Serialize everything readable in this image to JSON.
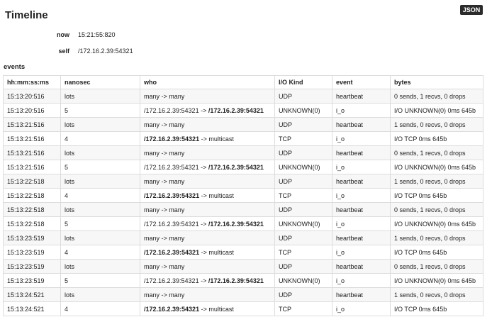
{
  "header": {
    "title": "Timeline",
    "json_button": "JSON"
  },
  "info": {
    "now_label": "now",
    "now_value": "15:21:55:820",
    "self_label": "self",
    "self_value": "/172.16.2.39:54321"
  },
  "events_label": "events",
  "table": {
    "columns": [
      "hh:mm:ss:ms",
      "nanosec",
      "who",
      "I/O Kind",
      "event",
      "bytes"
    ],
    "rows": [
      {
        "time": "15:13:20:516",
        "nanosec": "lots",
        "who": [
          {
            "t": "many -> many",
            "b": false
          }
        ],
        "kind": "UDP",
        "event": "heartbeat",
        "bytes": "0 sends, 1 recvs, 0 drops"
      },
      {
        "time": "15:13:20:516",
        "nanosec": "5",
        "who": [
          {
            "t": "/172.16.2.39:54321 -> ",
            "b": false
          },
          {
            "t": "/172.16.2.39:54321",
            "b": true
          }
        ],
        "kind": "UNKNOWN(0)",
        "event": "i_o",
        "bytes": "I/O UNKNOWN(0) 0ms 645b"
      },
      {
        "time": "15:13:21:516",
        "nanosec": "lots",
        "who": [
          {
            "t": "many -> many",
            "b": false
          }
        ],
        "kind": "UDP",
        "event": "heartbeat",
        "bytes": "1 sends, 0 recvs, 0 drops"
      },
      {
        "time": "15:13:21:516",
        "nanosec": "4",
        "who": [
          {
            "t": "/172.16.2.39:54321",
            "b": true
          },
          {
            "t": " -> multicast",
            "b": false
          }
        ],
        "kind": "TCP",
        "event": "i_o",
        "bytes": "I/O TCP 0ms 645b"
      },
      {
        "time": "15:13:21:516",
        "nanosec": "lots",
        "who": [
          {
            "t": "many -> many",
            "b": false
          }
        ],
        "kind": "UDP",
        "event": "heartbeat",
        "bytes": "0 sends, 1 recvs, 0 drops"
      },
      {
        "time": "15:13:21:516",
        "nanosec": "5",
        "who": [
          {
            "t": "/172.16.2.39:54321 -> ",
            "b": false
          },
          {
            "t": "/172.16.2.39:54321",
            "b": true
          }
        ],
        "kind": "UNKNOWN(0)",
        "event": "i_o",
        "bytes": "I/O UNKNOWN(0) 0ms 645b"
      },
      {
        "time": "15:13:22:518",
        "nanosec": "lots",
        "who": [
          {
            "t": "many -> many",
            "b": false
          }
        ],
        "kind": "UDP",
        "event": "heartbeat",
        "bytes": "1 sends, 0 recvs, 0 drops"
      },
      {
        "time": "15:13:22:518",
        "nanosec": "4",
        "who": [
          {
            "t": "/172.16.2.39:54321",
            "b": true
          },
          {
            "t": " -> multicast",
            "b": false
          }
        ],
        "kind": "TCP",
        "event": "i_o",
        "bytes": "I/O TCP 0ms 645b"
      },
      {
        "time": "15:13:22:518",
        "nanosec": "lots",
        "who": [
          {
            "t": "many -> many",
            "b": false
          }
        ],
        "kind": "UDP",
        "event": "heartbeat",
        "bytes": "0 sends, 1 recvs, 0 drops"
      },
      {
        "time": "15:13:22:518",
        "nanosec": "5",
        "who": [
          {
            "t": "/172.16.2.39:54321 -> ",
            "b": false
          },
          {
            "t": "/172.16.2.39:54321",
            "b": true
          }
        ],
        "kind": "UNKNOWN(0)",
        "event": "i_o",
        "bytes": "I/O UNKNOWN(0) 0ms 645b"
      },
      {
        "time": "15:13:23:519",
        "nanosec": "lots",
        "who": [
          {
            "t": "many -> many",
            "b": false
          }
        ],
        "kind": "UDP",
        "event": "heartbeat",
        "bytes": "1 sends, 0 recvs, 0 drops"
      },
      {
        "time": "15:13:23:519",
        "nanosec": "4",
        "who": [
          {
            "t": "/172.16.2.39:54321",
            "b": true
          },
          {
            "t": " -> multicast",
            "b": false
          }
        ],
        "kind": "TCP",
        "event": "i_o",
        "bytes": "I/O TCP 0ms 645b"
      },
      {
        "time": "15:13:23:519",
        "nanosec": "lots",
        "who": [
          {
            "t": "many -> many",
            "b": false
          }
        ],
        "kind": "UDP",
        "event": "heartbeat",
        "bytes": "0 sends, 1 recvs, 0 drops"
      },
      {
        "time": "15:13:23:519",
        "nanosec": "5",
        "who": [
          {
            "t": "/172.16.2.39:54321 -> ",
            "b": false
          },
          {
            "t": "/172.16.2.39:54321",
            "b": true
          }
        ],
        "kind": "UNKNOWN(0)",
        "event": "i_o",
        "bytes": "I/O UNKNOWN(0) 0ms 645b"
      },
      {
        "time": "15:13:24:521",
        "nanosec": "lots",
        "who": [
          {
            "t": "many -> many",
            "b": false
          }
        ],
        "kind": "UDP",
        "event": "heartbeat",
        "bytes": "1 sends, 0 recvs, 0 drops"
      },
      {
        "time": "15:13:24:521",
        "nanosec": "4",
        "who": [
          {
            "t": "/172.16.2.39:54321",
            "b": true
          },
          {
            "t": " -> multicast",
            "b": false
          }
        ],
        "kind": "TCP",
        "event": "i_o",
        "bytes": "I/O TCP 0ms 645b"
      }
    ]
  }
}
